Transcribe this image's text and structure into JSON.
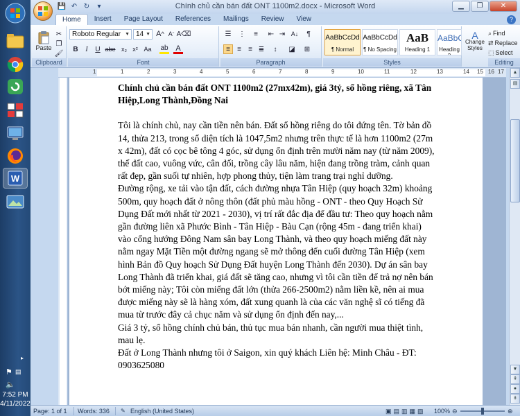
{
  "window": {
    "title": "Chính chủ cần bán đất ONT 1100m2.docx - Microsoft Word",
    "controls": {
      "minimize": "▁",
      "maximize": "❐",
      "close": "✕"
    }
  },
  "ribbon_tabs": [
    "Home",
    "Insert",
    "Page Layout",
    "References",
    "Mailings",
    "Review",
    "View"
  ],
  "clipboard": {
    "paste_label": "Paste",
    "group_label": "Clipboard"
  },
  "font": {
    "family": "Roboto Regular",
    "size": "14",
    "group_label": "Font"
  },
  "paragraph": {
    "group_label": "Paragraph"
  },
  "styles": {
    "group_label": "Styles",
    "items": [
      {
        "sample": "AaBbCcDd",
        "name": "¶ Normal"
      },
      {
        "sample": "AaBbCcDd",
        "name": "¶ No Spacing"
      },
      {
        "sample": "AaB",
        "name": "Heading 1"
      },
      {
        "sample": "AaBbCc",
        "name": "Heading 2"
      }
    ],
    "change_styles": "Change Styles"
  },
  "editing": {
    "group_label": "Editing",
    "find": "Find",
    "replace": "Replace",
    "select": "Select"
  },
  "ruler_numbers": [
    "1",
    "1",
    "2",
    "3",
    "4",
    "5",
    "6",
    "7",
    "8",
    "9",
    "10",
    "11",
    "12",
    "13",
    "14",
    "15",
    "16",
    "17"
  ],
  "document": {
    "title": "Chính chủ cần bán đất ONT 1100m2 (27mx42m), giá 3tỷ, sổ hồng riêng, xã Tân Hiệp,Long Thành,Đồng  Nai",
    "paragraphs": [
      "Tôi là chính chủ, nay cần tiền nên bán. Đất sổ hồng riêng do tôi đứng tên. Tờ bản đồ 14, thửa 213, trong sổ diện tích là 1047,5m2 nhưng trên thực tế là hơn 1100m2 (27m x 42m), đất có cọc bê tông 4 góc, sử dụng ổn định trên mười năm nay (từ năm 2009), thế đất cao, vuông vức, cân đối, trồng cây lâu năm, hiện đang trồng tràm, cảnh quan rất đẹp, gần suối tự nhiên, hợp phong thủy, tiện làm trang trại nghỉ dưỡng.",
      "Đường rộng, xe tải vào tận đất, cách đường nhựa Tân Hiệp (quy hoạch 32m) khoảng 500m, quy hoạch đất ở nông thôn (đất phủ màu hồng - ONT - theo Quy Hoạch Sử Dụng Đất mới nhất từ 2021 - 2030), vị trí rất đắc địa để đầu tư: Theo quy hoạch nằm gần đường liên xã Phước Bình - Tân Hiệp - Bàu Cạn (rộng 45m - đang triển khai) vào cổng hướng Đông Nam sân bay Long Thành, và theo quy hoạch miếng đất này nằm ngay Mặt Tiền một đường ngang sẽ mở thông đến cuối đường Tân Hiệp (xem hình Bản đồ Quy hoạch Sử Dụng Đất huyện Long Thành đến 2030). Dự án sân bay Long Thành đã triển khai, giá đất sẽ tăng cao, nhưng vì tôi cần tiền để trả nợ nên bán bớt miếng này; Tôi còn miếng đất lớn (thửa 266-2500m2) nằm liền kề, nên ai mua được miếng này sẽ là hàng xóm, đất xung quanh là của các văn nghệ sĩ có tiếng đã mua từ trước đây cả chục năm và sử dụng ổn định đến nay,...",
      "Giá 3 tỷ, sổ hồng chính chủ bán, thủ tục mua bán nhanh, cần người mua thiệt tình, mau lẹ.",
      "Đất ở Long Thành nhưng tôi ở Saigon, xin quý khách Liên hệ: Minh Châu - ĐT: 0903625080"
    ]
  },
  "status_bar": {
    "page": "Page: 1 of 1",
    "words": "Words: 336",
    "language": "English (United States)",
    "zoom": "100%"
  },
  "taskbar": {
    "time": "7:52 PM",
    "date": "4/11/2022"
  }
}
